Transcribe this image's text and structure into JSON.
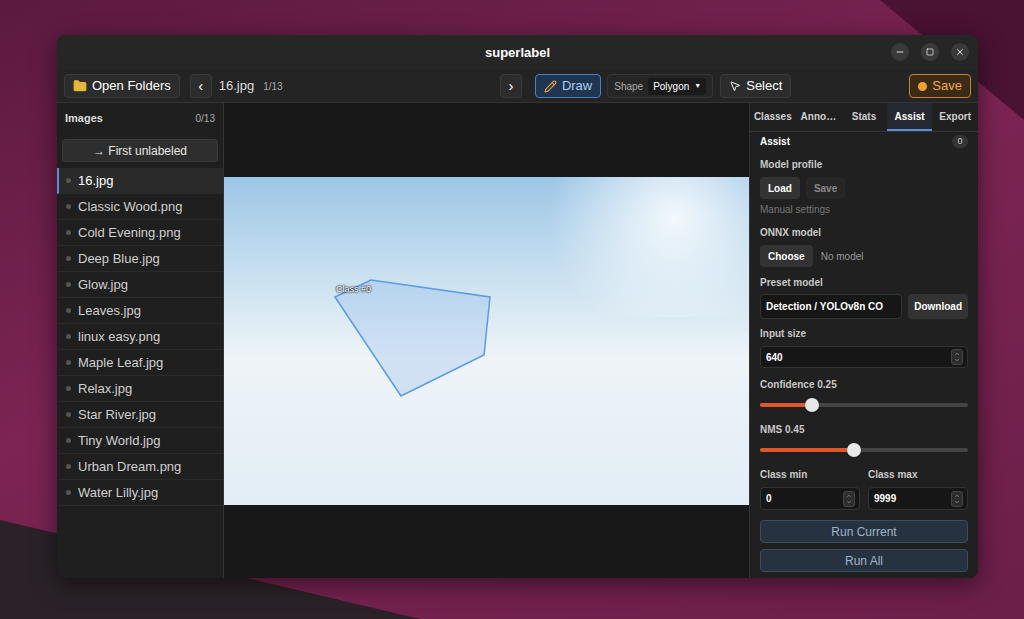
{
  "window": {
    "title": "superlabel"
  },
  "toolbar": {
    "open_folders": "Open Folders",
    "prev": "‹",
    "file": "16.jpg",
    "position": "1/13",
    "next": "›",
    "draw": {
      "label": "Draw",
      "selected": true
    },
    "shape": {
      "label": "Shape",
      "value": "Polygon",
      "arrow": "▼"
    },
    "select": {
      "label": "Select",
      "selected": false
    },
    "save": {
      "label": "Save",
      "unsaved": true
    }
  },
  "sidebar": {
    "title": "Images",
    "count": "0/13",
    "first_unlabeled": "→ First unlabeled",
    "items": [
      {
        "name": "16.jpg",
        "selected": true,
        "labeled": false
      },
      {
        "name": "Classic Wood.png",
        "selected": false,
        "labeled": false
      },
      {
        "name": "Cold Evening.png",
        "selected": false,
        "labeled": false
      },
      {
        "name": "Deep Blue.jpg",
        "selected": false,
        "labeled": false
      },
      {
        "name": "Glow.jpg",
        "selected": false,
        "labeled": false
      },
      {
        "name": "Leaves.jpg",
        "selected": false,
        "labeled": false
      },
      {
        "name": "linux easy.png",
        "selected": false,
        "labeled": false
      },
      {
        "name": "Maple Leaf.jpg",
        "selected": false,
        "labeled": false
      },
      {
        "name": "Relax.jpg",
        "selected": false,
        "labeled": false
      },
      {
        "name": "Star River.jpg",
        "selected": false,
        "labeled": false
      },
      {
        "name": "Tiny World.jpg",
        "selected": false,
        "labeled": false
      },
      {
        "name": "Urban Dream.png",
        "selected": false,
        "labeled": false
      },
      {
        "name": "Water Lilly.jpg",
        "selected": false,
        "labeled": false
      }
    ]
  },
  "canvas": {
    "annotations": [
      {
        "label": "Class #0"
      }
    ]
  },
  "panel": {
    "tabs": [
      {
        "label": "Classes",
        "selected": false
      },
      {
        "label": "Anno…",
        "selected": false
      },
      {
        "label": "Stats",
        "selected": false
      },
      {
        "label": "Assist",
        "selected": true
      },
      {
        "label": "Export",
        "selected": false
      }
    ],
    "header": {
      "title": "Assist",
      "badge": "0"
    },
    "model_profile": {
      "label": "Model profile",
      "buttons": [
        {
          "label": "Load",
          "disabled": false
        },
        {
          "label": "Save",
          "disabled": true
        }
      ],
      "note": "Manual settings"
    },
    "onnx_model": {
      "label": "ONNX model",
      "button": "Choose",
      "value": "No model"
    },
    "preset_model": {
      "label": "Preset model",
      "value": "Detection / YOLOv8n CO",
      "button": "Download"
    },
    "input_size": {
      "label": "Input size",
      "value": "640"
    },
    "sliders": [
      {
        "label": "Confidence 0.25",
        "level": 0.25
      },
      {
        "label": "NMS 0.45",
        "level": 0.45
      }
    ],
    "class_range": [
      {
        "label": "Class min",
        "value": "0"
      },
      {
        "label": "Class max",
        "value": "9999"
      }
    ],
    "actions": [
      "Run Current",
      "Run All"
    ]
  }
}
